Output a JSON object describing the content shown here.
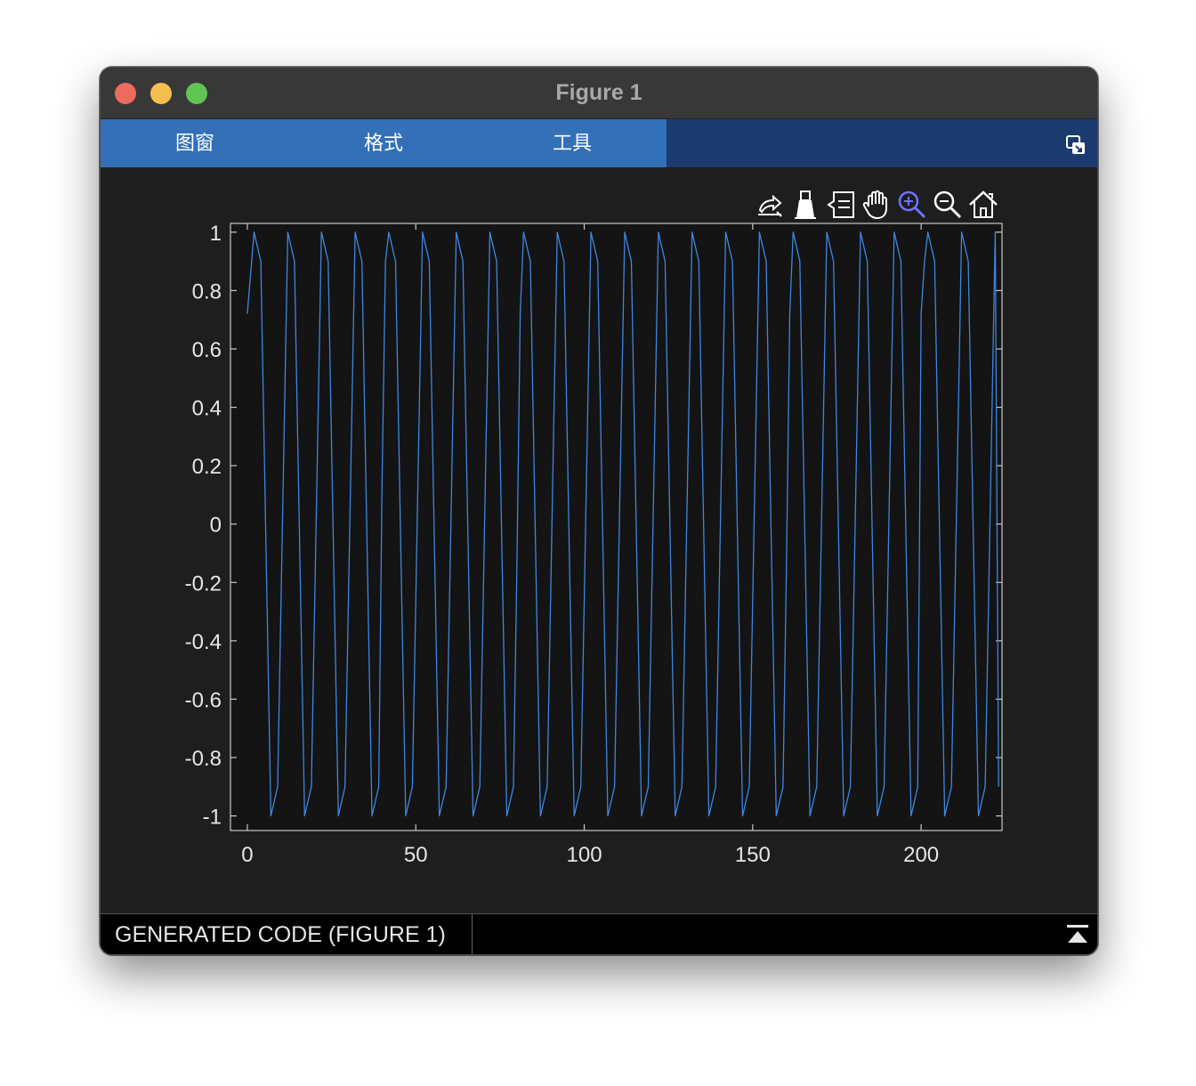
{
  "window": {
    "title": "Figure 1",
    "traffic_lights": [
      {
        "name": "close",
        "color": "#ed6a5e"
      },
      {
        "name": "minimize",
        "color": "#f5bf4f"
      },
      {
        "name": "zoom",
        "color": "#61c554"
      }
    ]
  },
  "menu": {
    "tabs": [
      "图窗",
      "格式",
      "工具"
    ],
    "undock_icon": "undock-icon"
  },
  "axes_toolbar": {
    "icons": [
      "export-icon",
      "brush-icon",
      "data-tips-icon",
      "pan-hand-icon",
      "zoom-in-icon",
      "zoom-out-icon",
      "home-icon"
    ],
    "active": "zoom-in-icon",
    "active_color": "#6b74ff"
  },
  "status": {
    "label": "GENERATED CODE (FIGURE 1)",
    "expand_icon": "expand-panel-icon"
  },
  "chart_data": {
    "type": "line",
    "title": "",
    "xlabel": "",
    "ylabel": "",
    "xlim": [
      -5,
      224
    ],
    "ylim": [
      -1.05,
      1.03
    ],
    "xticks": [
      0,
      50,
      100,
      150,
      200
    ],
    "yticks": [
      -1,
      -0.8,
      -0.6,
      -0.4,
      -0.2,
      0,
      0.2,
      0.4,
      0.6,
      0.8,
      1
    ],
    "ytick_labels": [
      "-1",
      "-0.8",
      "-0.6",
      "-0.4",
      "-0.2",
      "0",
      "0.2",
      "0.4",
      "0.6",
      "0.8",
      "1"
    ],
    "grid": false,
    "series": [
      {
        "color": "#3f86e0",
        "x": [
          0,
          2,
          4,
          7,
          9,
          12,
          14,
          17,
          19,
          22,
          24,
          27,
          29,
          32,
          34,
          37,
          39,
          40,
          41,
          42,
          44,
          47,
          49,
          52,
          54,
          57,
          59,
          62,
          64,
          67,
          69,
          72,
          74,
          77,
          79,
          80,
          81,
          82,
          84,
          87,
          89,
          92,
          94,
          97,
          99,
          102,
          104,
          107,
          109,
          112,
          114,
          117,
          119,
          122,
          124,
          127,
          129,
          132,
          134,
          137,
          139,
          142,
          144,
          147,
          149,
          152,
          154,
          157,
          159,
          160,
          161,
          162,
          164,
          167,
          169,
          172,
          174,
          177,
          179,
          182,
          184,
          187,
          189,
          192,
          194,
          197,
          199,
          200,
          201,
          202,
          204,
          207,
          209,
          212,
          214,
          217,
          219,
          222,
          223
        ],
        "y": [
          0.72,
          1.0,
          0.9,
          -1.0,
          -0.9,
          1.0,
          0.9,
          -1.0,
          -0.9,
          1.0,
          0.9,
          -1.0,
          -0.9,
          1.0,
          0.9,
          -1.0,
          -0.9,
          0.16,
          0.9,
          1.0,
          0.9,
          -1.0,
          -0.9,
          1.0,
          0.9,
          -1.0,
          -0.9,
          1.0,
          0.9,
          -1.0,
          -0.9,
          1.0,
          0.9,
          -1.0,
          -0.9,
          -0.16,
          0.72,
          1.0,
          0.9,
          -1.0,
          -0.9,
          1.0,
          0.9,
          -1.0,
          -0.9,
          1.0,
          0.9,
          -1.0,
          -0.9,
          1.0,
          0.9,
          -1.0,
          -0.9,
          1.0,
          0.9,
          -1.0,
          -0.9,
          1.0,
          0.9,
          -1.0,
          -0.9,
          1.0,
          0.9,
          -1.0,
          -0.9,
          1.0,
          0.9,
          -1.0,
          -0.9,
          -0.16,
          0.72,
          1.0,
          0.9,
          -1.0,
          -0.9,
          1.0,
          0.9,
          -1.0,
          -0.9,
          1.0,
          0.9,
          -1.0,
          -0.9,
          1.0,
          0.9,
          -1.0,
          -0.9,
          0.72,
          0.9,
          1.0,
          0.9,
          -1.0,
          -0.9,
          1.0,
          0.9,
          -1.0,
          -0.9,
          1.0,
          -0.9
        ]
      }
    ]
  }
}
